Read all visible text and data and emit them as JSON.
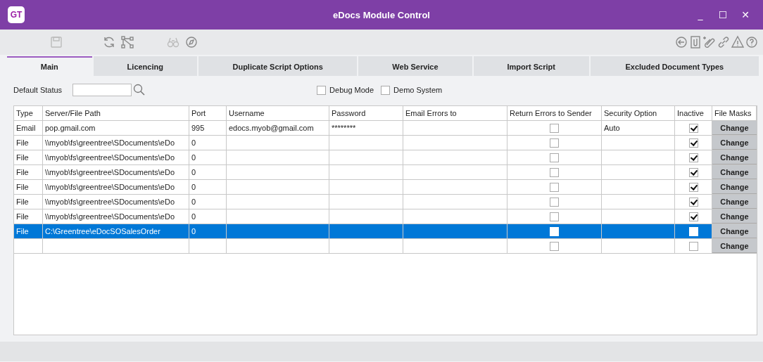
{
  "window": {
    "logo": "GT",
    "title": "eDocs Module Control",
    "controls": [
      "_",
      "☐",
      "✕"
    ]
  },
  "tabs": [
    {
      "label": "Main",
      "selected": true
    },
    {
      "label": "Licencing",
      "selected": false
    },
    {
      "label": "Duplicate Script Options",
      "selected": false
    },
    {
      "label": "Web Service",
      "selected": false
    },
    {
      "label": "Import Script",
      "selected": false
    },
    {
      "label": "Excluded Document Types",
      "selected": false
    }
  ],
  "filters": {
    "default_status_label": "Default Status",
    "debug_mode": {
      "label": "Debug Mode",
      "checked": false
    },
    "demo_system": {
      "label": "Demo System",
      "checked": false
    }
  },
  "table": {
    "columns": [
      "Type",
      "Server/File Path",
      "Port",
      "Username",
      "Password",
      "Email Errors to",
      "Return Errors to Sender",
      "Security Option",
      "Inactive",
      "File Masks"
    ],
    "rows": [
      {
        "type": "Email",
        "path": "pop.gmail.com",
        "port": "995",
        "username": "edocs.myob@gmail.com",
        "password": "********",
        "return_errors": false,
        "security": "Auto",
        "inactive": true,
        "selected": false,
        "button": "Change"
      },
      {
        "type": "File",
        "path": "\\\\myob\\fs\\greentree\\SDocuments\\eDo",
        "port": "0",
        "return_errors": false,
        "inactive": true,
        "selected": false,
        "button": "Change"
      },
      {
        "type": "File",
        "path": "\\\\myob\\fs\\greentree\\SDocuments\\eDo",
        "port": "0",
        "return_errors": false,
        "inactive": true,
        "selected": false,
        "button": "Change"
      },
      {
        "type": "File",
        "path": "\\\\myob\\fs\\greentree\\SDocuments\\eDo",
        "port": "0",
        "return_errors": false,
        "inactive": true,
        "selected": false,
        "button": "Change"
      },
      {
        "type": "File",
        "path": "\\\\myob\\fs\\greentree\\SDocuments\\eDo",
        "port": "0",
        "return_errors": false,
        "inactive": true,
        "selected": false,
        "button": "Change"
      },
      {
        "type": "File",
        "path": "\\\\myob\\fs\\greentree\\SDocuments\\eDo",
        "port": "0",
        "return_errors": false,
        "inactive": true,
        "selected": false,
        "button": "Change"
      },
      {
        "type": "File",
        "path": "\\\\myob\\fs\\greentree\\SDocuments\\eDo",
        "port": "0",
        "return_errors": false,
        "inactive": true,
        "selected": false,
        "button": "Change"
      },
      {
        "type": "File",
        "path": "C:\\Greentree\\eDocSOSalesOrder",
        "port": "0",
        "return_errors": false,
        "inactive": false,
        "selected": true,
        "button": "Change"
      },
      {
        "return_errors": false,
        "inactive": false,
        "selected": false,
        "button": "Change"
      }
    ]
  }
}
